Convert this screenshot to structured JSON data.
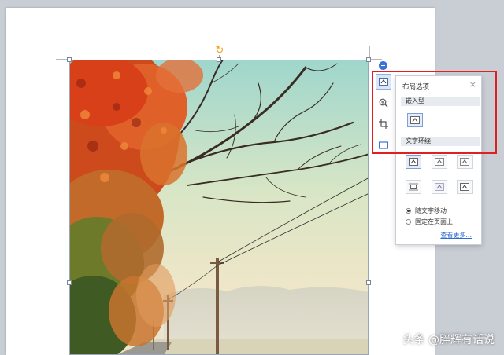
{
  "layout_panel": {
    "title": "布局选项",
    "close_glyph": "×",
    "inline_section": "嵌入型",
    "wrap_section": "文字环绕",
    "radio_move_with_text": "随文字移动",
    "radio_fixed_position": "固定在页面上",
    "see_more": "查看更多...",
    "selected_radio": "move_with_text"
  },
  "side_toolbar": {
    "tools": [
      {
        "icon": "layout-options-icon",
        "active": true
      },
      {
        "icon": "zoom-icon",
        "active": false
      },
      {
        "icon": "crop-icon",
        "active": false
      },
      {
        "icon": "border-icon",
        "active": false
      }
    ]
  },
  "watermark": "头条 @胖辉有话说",
  "colors": {
    "highlight_box": "#e02020",
    "accent": "#3b73d6",
    "rotate_handle": "#f3a010"
  }
}
